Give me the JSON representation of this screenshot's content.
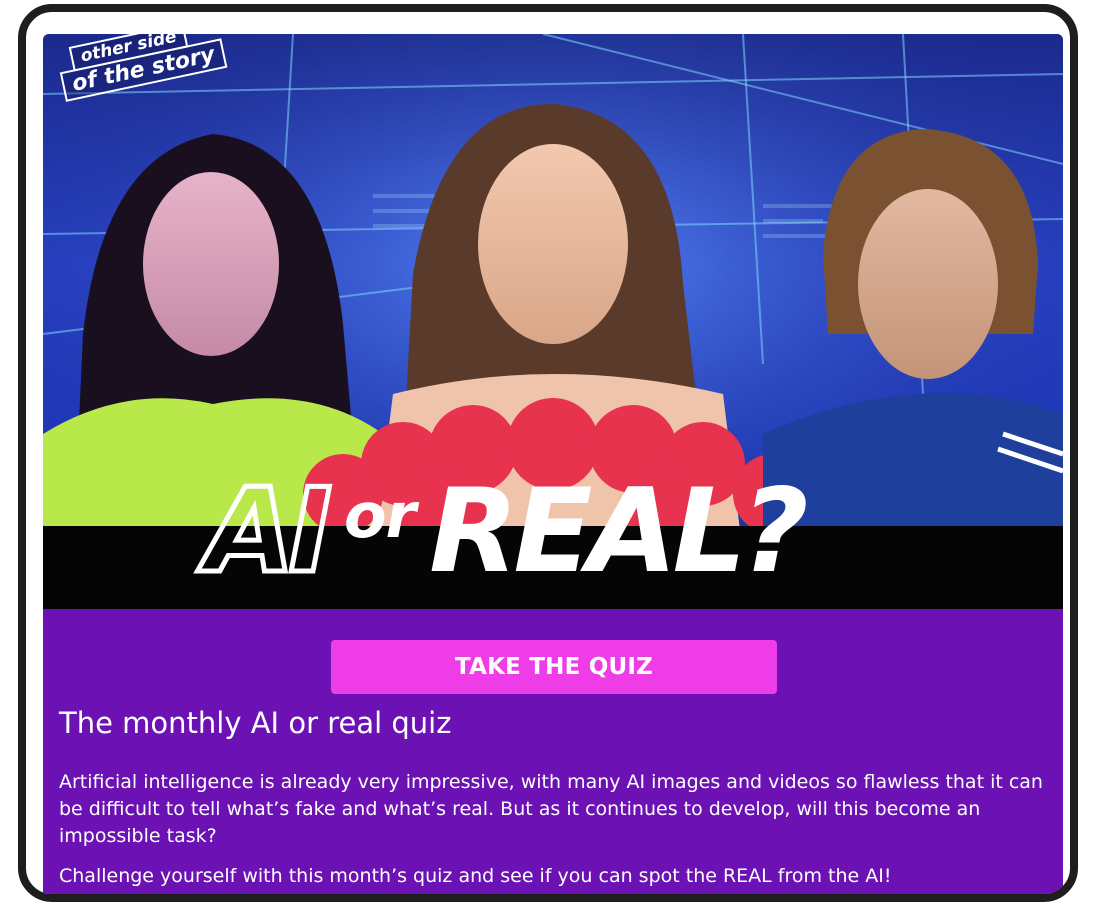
{
  "hero": {
    "brand_line1": "other side",
    "brand_line2": "of the story",
    "title_part1": "AI",
    "title_part2": "or",
    "title_part3": "REAL?"
  },
  "quiz_button_label": "TAKE THE QUIZ",
  "heading": "The monthly AI or real quiz",
  "paragraphs": [
    "Artificial intelligence is already very impressive, with many AI images and videos so flawless that it can be difficult to tell what’s fake and what’s real. But as it continues to develop, will this become an impossible task?",
    "Challenge yourself with this month’s quiz and see if you can spot the REAL from the AI!"
  ],
  "colors": {
    "card_background": "#6c12b4",
    "button_background": "#ee3ce6",
    "frame_border": "#1e1e1e",
    "hero_band": "#050505"
  }
}
